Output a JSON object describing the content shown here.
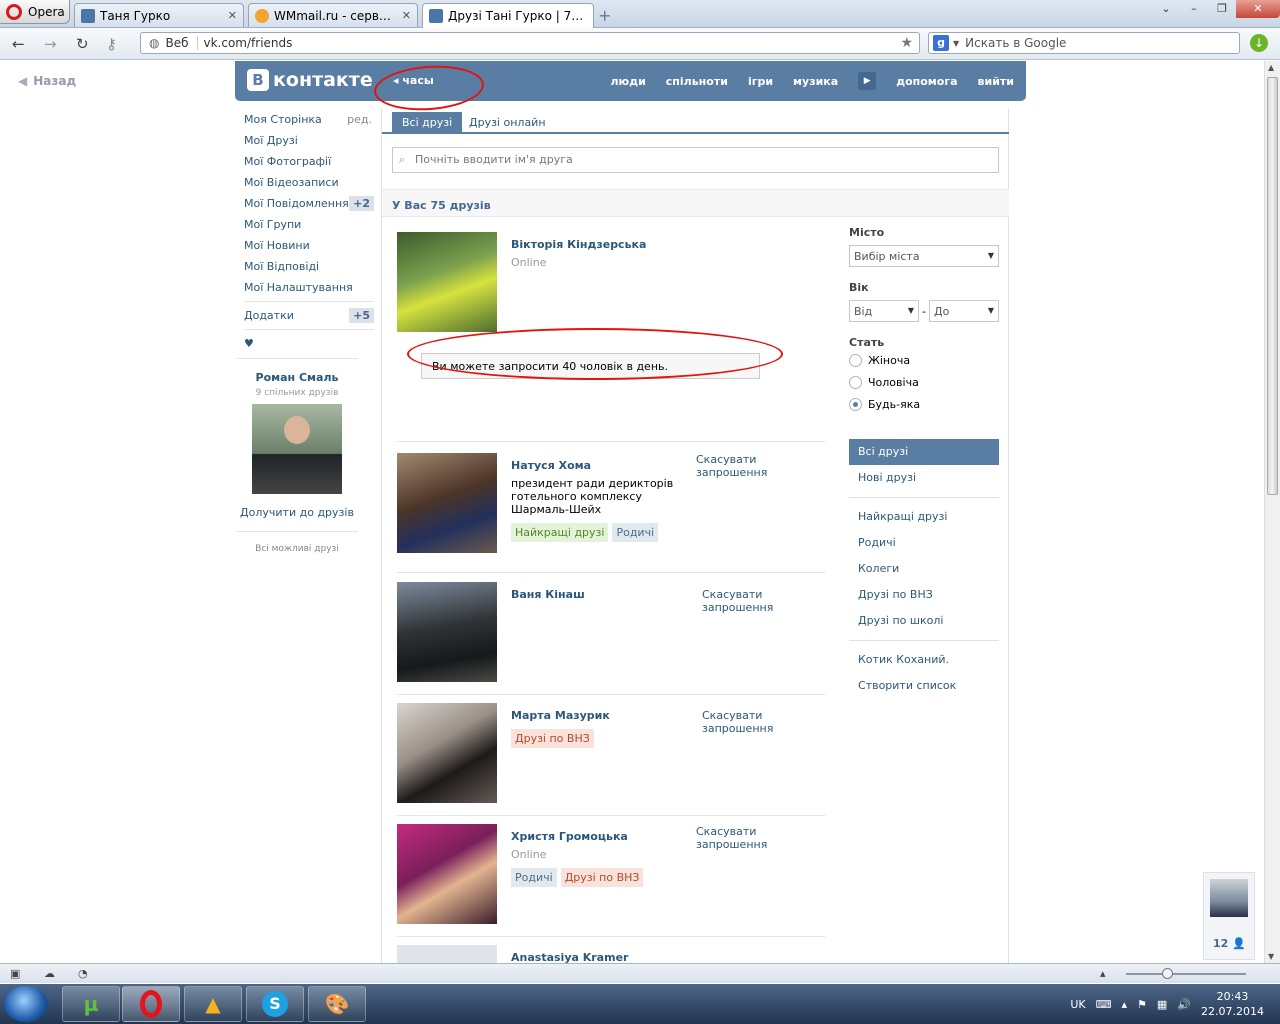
{
  "browser": {
    "opera_label": "Opera",
    "tabs": [
      {
        "label": "Таня Гурко",
        "icon": "vk-icon",
        "active": false
      },
      {
        "label": "WMmail.ru - сервис п...",
        "icon": "wmmail-icon",
        "active": false
      },
      {
        "label": "Друзі Тані Гурко | 75 д...",
        "icon": "vk-icon",
        "active": true
      }
    ],
    "address_prefix": "Веб",
    "url": "vk.com/friends",
    "search_placeholder": "Искать в Google"
  },
  "page": {
    "back_label": "Назад",
    "header": {
      "logo_letter": "В",
      "logo_text": "контакте",
      "back_label": "часы",
      "nav": [
        "люди",
        "спільноти",
        "ігри",
        "музика",
        "допомога",
        "вийти"
      ]
    },
    "left_menu": {
      "items": [
        {
          "label": "Моя Сторінка",
          "extra": "ред."
        },
        {
          "label": "Мої Друзі"
        },
        {
          "label": "Мої Фотографії"
        },
        {
          "label": "Мої Відеозаписи"
        },
        {
          "label": "Мої Повідомлення",
          "count": "+2"
        },
        {
          "label": "Мої Групи"
        },
        {
          "label": "Мої Новини"
        },
        {
          "label": "Мої Відповіді"
        },
        {
          "label": "Мої Налаштування"
        }
      ],
      "apps_label": "Додатки",
      "apps_count": "+5",
      "heart": "♥"
    },
    "suggestion": {
      "name": "Роман Смаль",
      "mutual": "9 спільних друзів",
      "add_label": "Долучити до друзів",
      "all_label": "Всі можливі друзі"
    },
    "tabs": [
      "Всі друзі",
      "Друзі онлайн"
    ],
    "search_placeholder": "Почніть вводити ім'я друга",
    "summary": "У Вас 75 друзів",
    "tooltip": "Ви можете запросити 40 чоловік в день.",
    "friends": [
      {
        "name": "Вікторія Кіндзерська",
        "status": "Online",
        "action": "",
        "desc": "",
        "tags": []
      },
      {
        "name": "Натуся Хома",
        "status": "",
        "action": "Скасувати запрошення",
        "desc": "президент ради дериктoрів готельного комплексу Шармаль-Шейх",
        "tags": [
          "Найкращі друзі",
          "Родичі"
        ]
      },
      {
        "name": "Ваня Кінаш",
        "status": "",
        "action": "Скасувати запрошення",
        "desc": "",
        "tags": []
      },
      {
        "name": "Марта Мазурик",
        "status": "",
        "action": "Скасувати запрошення",
        "desc": "",
        "tags": [
          "Друзі по ВНЗ"
        ]
      },
      {
        "name": "Христя Громоцька",
        "status": "Online",
        "action": "Скасувати запрошення",
        "desc": "",
        "tags": [
          "Родичі",
          "Друзі по ВНЗ"
        ]
      },
      {
        "name": "Anastasiya Kramer",
        "status": "",
        "action": "",
        "desc": "",
        "tags": []
      }
    ],
    "filters": {
      "city_label": "Місто",
      "city_value": "Вибір міста",
      "age_label": "Вік",
      "age_from": "Від",
      "age_to": "До",
      "age_dash": "-",
      "gender_label": "Стать",
      "gender_options": [
        "Жіноча",
        "Чоловіча",
        "Будь-яка"
      ],
      "gender_selected": "Будь-яка"
    },
    "lists": {
      "group1": [
        "Всі друзі",
        "Нові друзі"
      ],
      "group2": [
        "Найкращі друзі",
        "Родичі",
        "Колеги",
        "Друзі по ВНЗ",
        "Друзі по школі"
      ],
      "group3": [
        "Котик Коханий.",
        "Створити список"
      ]
    },
    "chat_count": "12"
  },
  "taskbar": {
    "lang": "UK",
    "time": "20:43",
    "date": "22.07.2014"
  },
  "colors": {
    "vk_blue": "#597da3",
    "link": "#2b587a",
    "annotation_red": "#e2140f"
  }
}
